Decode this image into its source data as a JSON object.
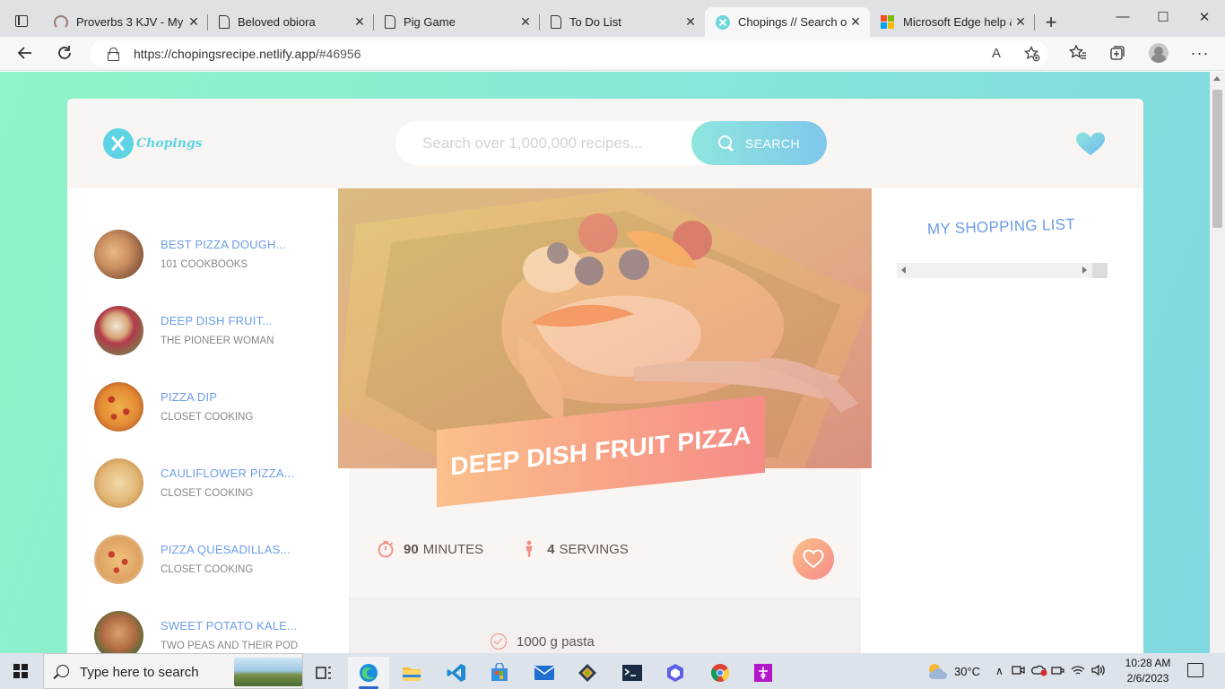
{
  "browser": {
    "tabs": [
      {
        "title": "Proverbs 3 KJV - My sc",
        "icon": "rope-icon",
        "active": false
      },
      {
        "title": "Beloved obiora",
        "icon": "document-icon",
        "active": false
      },
      {
        "title": "Pig Game",
        "icon": "document-icon",
        "active": false
      },
      {
        "title": "To Do List",
        "icon": "document-icon",
        "active": false
      },
      {
        "title": "Chopings // Search ov",
        "icon": "chopings-favicon",
        "active": true
      },
      {
        "title": "Microsoft Edge help &",
        "icon": "microsoft-icon",
        "active": false
      }
    ],
    "close_glyph": "✕",
    "new_tab_glyph": "+",
    "url_host": "https://chopingsrecipe.netlify.app/",
    "url_hash": "#46956",
    "read_aloud_glyph": "A",
    "window": {
      "minimize": "—",
      "maximize": "☐",
      "close": "✕"
    }
  },
  "app": {
    "logo_text": "Chopings",
    "search": {
      "placeholder": "Search over 1,000,000 recipes...",
      "button_label": "SEARCH"
    },
    "results": [
      {
        "title": "BEST PIZZA DOUGH...",
        "publisher": "101 COOKBOOKS"
      },
      {
        "title": "DEEP DISH FRUIT...",
        "publisher": "THE PIONEER WOMAN"
      },
      {
        "title": "PIZZA DIP",
        "publisher": "CLOSET COOKING"
      },
      {
        "title": "CAULIFLOWER PIZZA...",
        "publisher": "CLOSET COOKING"
      },
      {
        "title": "PIZZA QUESADILLAS...",
        "publisher": "CLOSET COOKING"
      },
      {
        "title": "SWEET POTATO KALE...",
        "publisher": "TWO PEAS AND THEIR POD"
      }
    ],
    "recipe": {
      "title": "DEEP DISH FRUIT PIZZA",
      "minutes": "90",
      "minutes_label": "MINUTES",
      "servings": "4",
      "servings_label": "SERVINGS",
      "ingredients": [
        {
          "amount": "1000",
          "unit": "g",
          "name": "pasta"
        }
      ]
    },
    "shopping_title": "MY SHOPPING LIST",
    "colors": {
      "brand_teal": "#5ed3e4",
      "link_blue": "#6c9ce8",
      "accent_orange": "#f58b86"
    }
  },
  "taskbar": {
    "search_placeholder": "Type here to search",
    "weather": "30°C",
    "time": "10:28 AM",
    "date": "2/6/2023"
  }
}
